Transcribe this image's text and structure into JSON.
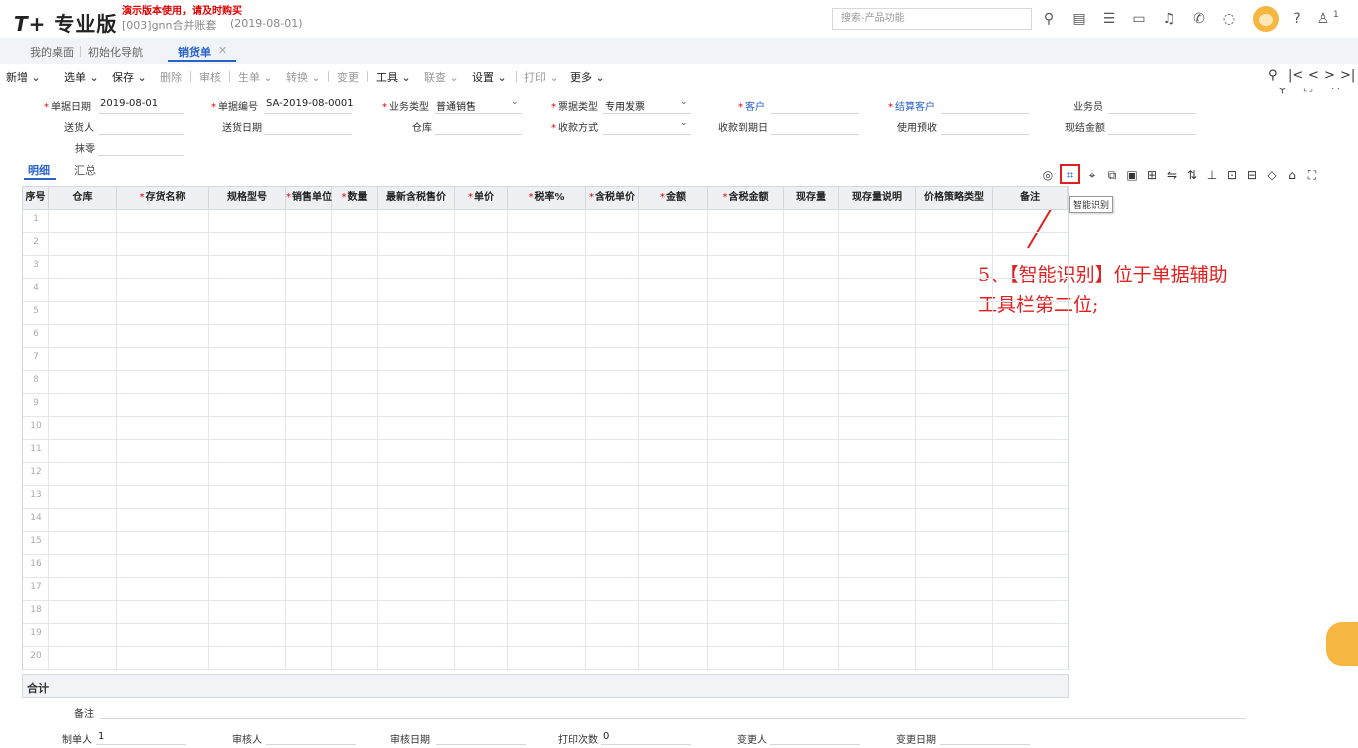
{
  "header": {
    "logo_prefix": "T+",
    "logo_text": "专业版",
    "demo_notice": "演示版本使用，请及时购买",
    "account": "[003]gnn合并账套",
    "account_date": "(2019-08-01)",
    "search_placeholder": "搜索-产品功能",
    "user_count": "1"
  },
  "tabs": [
    {
      "label": "我的桌面"
    },
    {
      "label": "初始化导航"
    },
    {
      "label": "销货单"
    }
  ],
  "toolbar": {
    "new": "新增",
    "select": "选单",
    "save": "保存",
    "delete": "删除",
    "audit": "审核",
    "generate": "生单",
    "convert": "转换",
    "change": "变更",
    "tools": "工具",
    "lookup": "联查",
    "settings": "设置",
    "print": "打印",
    "more": "更多"
  },
  "form": {
    "doc_date_label": "单据日期",
    "doc_date_value": "2019-08-01",
    "doc_no_label": "单据编号",
    "doc_no_value": "SA-2019-08-0001",
    "biz_type_label": "业务类型",
    "biz_type_value": "普通销售",
    "invoice_type_label": "票据类型",
    "invoice_type_value": "专用发票",
    "customer_label": "客户",
    "settle_customer_label": "结算客户",
    "salesman_label": "业务员",
    "deliverer_label": "送货人",
    "delivery_date_label": "送货日期",
    "warehouse_label": "仓库",
    "payment_method_label": "收款方式",
    "due_date_label": "收款到期日",
    "use_prepaid_label": "使用预收",
    "cash_amount_label": "现结金额",
    "rounding_label": "抹零"
  },
  "subtabs": {
    "detail": "明细",
    "summary": "汇总"
  },
  "table": {
    "columns": [
      {
        "label": "序号",
        "required": false
      },
      {
        "label": "仓库",
        "required": false
      },
      {
        "label": "存货名称",
        "required": true
      },
      {
        "label": "规格型号",
        "required": false
      },
      {
        "label": "销售单位",
        "required": true
      },
      {
        "label": "数量",
        "required": true
      },
      {
        "label": "最新含税售价",
        "required": false
      },
      {
        "label": "单价",
        "required": true
      },
      {
        "label": "税率%",
        "required": true
      },
      {
        "label": "含税单价",
        "required": true
      },
      {
        "label": "金额",
        "required": true
      },
      {
        "label": "含税金额",
        "required": true
      },
      {
        "label": "现存量",
        "required": false
      },
      {
        "label": "现存量说明",
        "required": false
      },
      {
        "label": "价格策略类型",
        "required": false
      },
      {
        "label": "备注",
        "required": false
      }
    ],
    "row_numbers": [
      "1",
      "2",
      "3",
      "4",
      "5",
      "6",
      "7",
      "8",
      "9",
      "10",
      "11",
      "12",
      "13",
      "14",
      "15",
      "16",
      "17",
      "18",
      "19",
      "20"
    ],
    "total_label": "合计"
  },
  "tooltip": "智能识别",
  "annotation": {
    "line1": "5、【智能识别】位于单据辅助",
    "line2": "工具栏第二位;"
  },
  "footer": {
    "remark_label": "备注",
    "maker_label": "制单人",
    "maker_value": "1",
    "auditor_label": "审核人",
    "audit_date_label": "审核日期",
    "print_count_label": "打印次数",
    "print_count_value": "0",
    "changer_label": "变更人",
    "change_date_label": "变更日期"
  },
  "colors": {
    "accent": "#2962c9",
    "required": "#e00000",
    "annotation": "#e02020"
  }
}
